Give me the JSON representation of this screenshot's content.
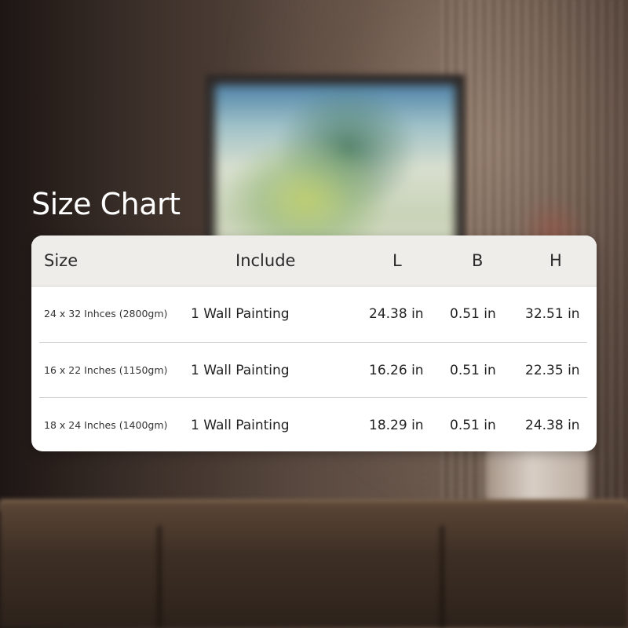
{
  "page": {
    "title": "Size Chart"
  },
  "size_chart": {
    "headers": {
      "size": "Size",
      "include": "Include",
      "l": "L",
      "b": "B",
      "h": "H"
    },
    "rows": [
      {
        "size": "24 x 32 Inhces (2800gm)",
        "include": "1 Wall Painting",
        "l": "24.38 in",
        "b": "0.51 in",
        "h": "32.51 in"
      },
      {
        "size": "16 x 22 Inches (1150gm)",
        "include": "1 Wall Painting",
        "l": "16.26 in",
        "b": "0.51 in",
        "h": "22.35 in"
      },
      {
        "size": "18 x 24 Inches (1400gm)",
        "include": "1 Wall Painting",
        "l": "18.29 in",
        "b": "0.51 in",
        "h": "24.38 in"
      }
    ]
  },
  "colors": {
    "title_text": "#ffffff",
    "table_header_bg": "#efedea",
    "table_body_bg": "#ffffff",
    "table_text": "#222222",
    "row_divider": "#cfcfcf"
  }
}
